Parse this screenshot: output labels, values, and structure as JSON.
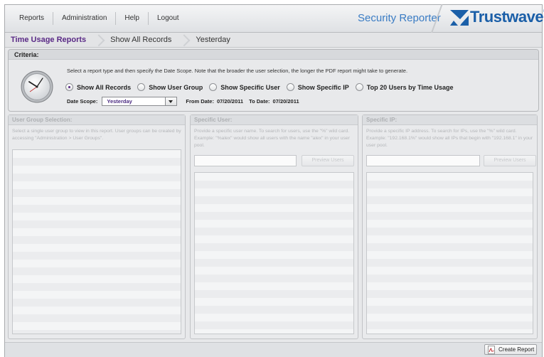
{
  "menu": {
    "items": [
      "Reports",
      "Administration",
      "Help",
      "Logout"
    ]
  },
  "brand": {
    "product": "Security Reporter",
    "logo_text": "Trustwave",
    "logo_reg": "®"
  },
  "breadcrumb": [
    "Time Usage Reports",
    "Show All Records",
    "Yesterday"
  ],
  "criteria": {
    "title": "Criteria:",
    "instructions": "Select a report type and then specify the Date Scope. Note that the broader the user selection, the longer the PDF report might take to generate.",
    "radios": [
      {
        "label": "Show All Records",
        "checked": true
      },
      {
        "label": "Show User Group",
        "checked": false
      },
      {
        "label": "Show Specific User",
        "checked": false
      },
      {
        "label": "Show Specific IP",
        "checked": false
      },
      {
        "label": "Top 20 Users by Time Usage",
        "checked": false
      }
    ],
    "date_scope_label": "Date Scope:",
    "date_scope_value": "Yesterday",
    "from_label": "From Date:",
    "from_value": "07/20/2011",
    "to_label": "To Date:",
    "to_value": "07/20/2011"
  },
  "panels": {
    "group": {
      "title": "User Group Selection:",
      "desc": "Select a single user group to view in this report. User groups can be created by accessing \"Administration > User Groups\"."
    },
    "user": {
      "title": "Specific User:",
      "desc": "Provide a specific user name. To search for users, use the \"%\" wild card. Example: \"%alex\" would show all users with the name \"alex\" in your user pool.",
      "button": "Preview Users"
    },
    "ip": {
      "title": "Specific IP:",
      "desc": "Provide a specific IP address. To search for IPs, use the \"%\" wild card. Example: \"192.168.1%\" would show all IPs that begin with \"192.168.1\" in your user pool.",
      "button": "Preview Users"
    }
  },
  "footer": {
    "create_report": "Create Report"
  }
}
